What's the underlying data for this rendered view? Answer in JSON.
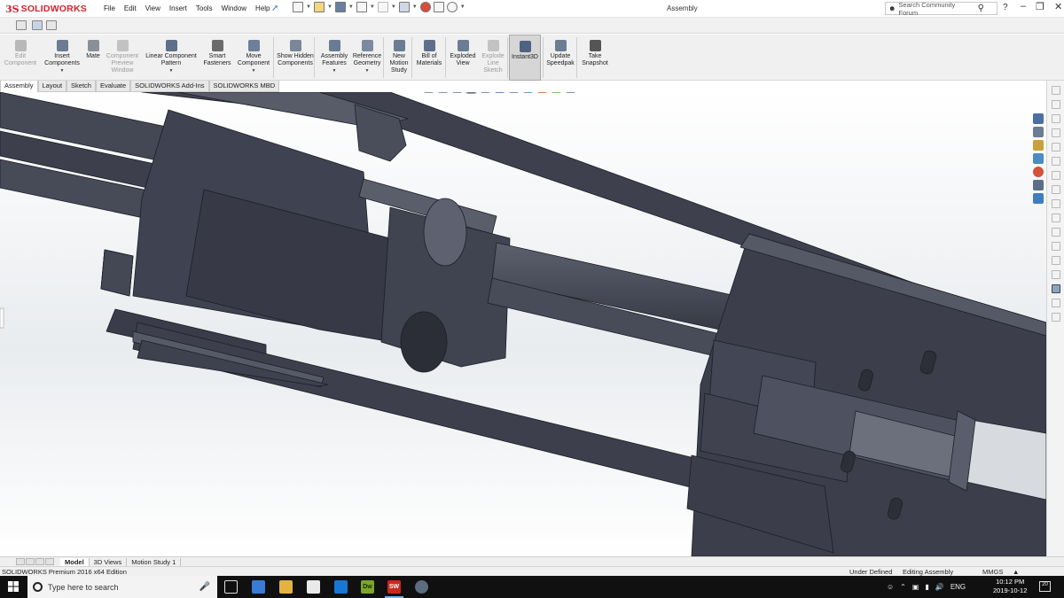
{
  "app": {
    "logo_ds": "3S",
    "logo_text": "SOLIDWORKS",
    "document_title": "Assembly",
    "search_placeholder": "Search Community Forum",
    "help": "?"
  },
  "menus": [
    "File",
    "Edit",
    "View",
    "Insert",
    "Tools",
    "Window",
    "Help"
  ],
  "ribbon": {
    "buttons": [
      {
        "label": "Edit Component",
        "enabled": false,
        "icon": "edit-component-icon",
        "color": "#b8b8b8",
        "has_dropdown": false
      },
      {
        "label": "Insert Components",
        "enabled": true,
        "icon": "insert-components-icon",
        "color": "#6b7c93",
        "has_dropdown": true
      },
      {
        "label": "Mate",
        "enabled": true,
        "icon": "mate-icon",
        "color": "#8a8f98",
        "has_dropdown": false
      },
      {
        "label": "Component Preview Window",
        "enabled": false,
        "icon": "preview-window-icon",
        "color": "#c2c2c2",
        "has_dropdown": false
      },
      {
        "label": "Linear Component Pattern",
        "enabled": true,
        "icon": "linear-pattern-icon",
        "color": "#5d6f8a",
        "has_dropdown": true
      },
      {
        "label": "Smart Fasteners",
        "enabled": true,
        "icon": "smart-fasteners-icon",
        "color": "#6a6a6a",
        "has_dropdown": false
      },
      {
        "label": "Move Component",
        "enabled": true,
        "icon": "move-component-icon",
        "color": "#6d7f99",
        "has_dropdown": true
      },
      {
        "label": "Show Hidden Components",
        "enabled": true,
        "icon": "show-hidden-icon",
        "color": "#7b8799",
        "has_dropdown": false
      },
      {
        "label": "Assembly Features",
        "enabled": true,
        "icon": "assembly-features-icon",
        "color": "#6a7b95",
        "has_dropdown": true
      },
      {
        "label": "Reference Geometry",
        "enabled": true,
        "icon": "reference-geometry-icon",
        "color": "#7c8aa0",
        "has_dropdown": true
      },
      {
        "label": "New Motion Study",
        "enabled": true,
        "icon": "motion-study-icon",
        "color": "#6b7c93",
        "has_dropdown": false
      },
      {
        "label": "Bill of Materials",
        "enabled": true,
        "icon": "bill-of-materials-icon",
        "color": "#5d6f8a",
        "has_dropdown": false
      },
      {
        "label": "Exploded View",
        "enabled": true,
        "icon": "exploded-view-icon",
        "color": "#6b7c93",
        "has_dropdown": false
      },
      {
        "label": "Explode Line Sketch",
        "enabled": false,
        "icon": "explode-line-sketch-icon",
        "color": "#c2c2c2",
        "has_dropdown": false
      },
      {
        "label": "Instant3D",
        "enabled": true,
        "active": true,
        "icon": "instant3d-icon",
        "color": "#4f6380",
        "has_dropdown": false
      },
      {
        "label": "Update Speedpak",
        "enabled": true,
        "icon": "update-speedpak-icon",
        "color": "#6b7c93",
        "has_dropdown": false
      },
      {
        "label": "Take Snapshot",
        "enabled": true,
        "icon": "take-snapshot-icon",
        "color": "#555555",
        "has_dropdown": false
      }
    ]
  },
  "tabs": [
    {
      "label": "Assembly",
      "active": true
    },
    {
      "label": "Layout",
      "active": false
    },
    {
      "label": "Sketch",
      "active": false
    },
    {
      "label": "Evaluate",
      "active": false
    },
    {
      "label": "SOLIDWORKS Add-Ins",
      "active": false
    },
    {
      "label": "SOLIDWORKS MBD",
      "active": false
    }
  ],
  "bottom_tabs": [
    {
      "label": "Model",
      "active": true
    },
    {
      "label": "3D Views",
      "active": false
    },
    {
      "label": "Motion Study 1",
      "active": false
    }
  ],
  "status": {
    "edition": "SOLIDWORKS Premium 2016 x64 Edition",
    "definition": "Under Defined",
    "mode": "Editing Assembly",
    "units": "MMGS"
  },
  "taskbar": {
    "search_placeholder": "Type here to search",
    "dw_label": "Dw",
    "sw_label": "SW",
    "language": "ENG",
    "time": "10:12 PM",
    "date": "2019-10-12",
    "notifications": "20"
  },
  "colors": {
    "brand": "#d2232a",
    "part_face": "#3f4250",
    "part_top": "#5a5e6b",
    "part_edge": "#1e2028",
    "viewport_bg": "#eef0f2"
  }
}
